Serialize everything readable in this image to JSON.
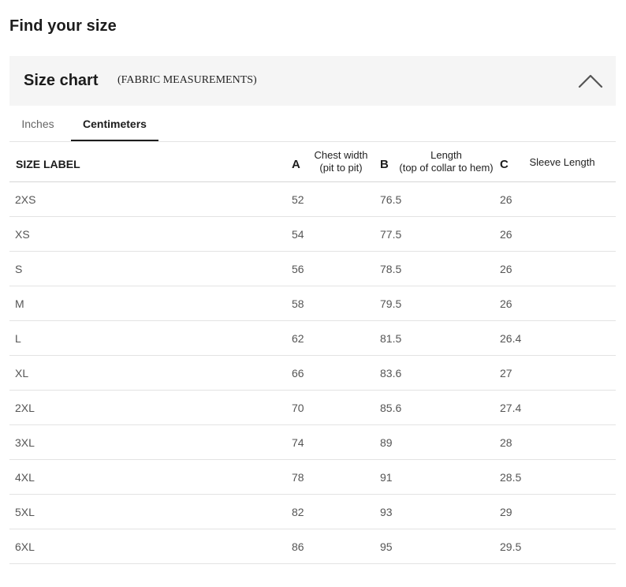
{
  "page": {
    "title": "Find your size"
  },
  "size_chart": {
    "title": "Size chart",
    "subtitle": "(FABRIC MEASUREMENTS)",
    "collapse_icon": "chevron-up-icon",
    "tabs": [
      {
        "label": "Inches",
        "active": false
      },
      {
        "label": "Centimeters",
        "active": true
      }
    ],
    "headers": {
      "size_label": "SIZE LABEL",
      "a_letter": "A",
      "a_line1": "Chest width",
      "a_line2": "(pit to pit)",
      "b_letter": "B",
      "b_line1": "Length",
      "b_line2": "(top of collar to hem)",
      "c_letter": "C",
      "c_label": "Sleeve Length"
    },
    "rows": [
      {
        "size": "2XS",
        "a": "52",
        "b": "76.5",
        "c": "26"
      },
      {
        "size": "XS",
        "a": "54",
        "b": "77.5",
        "c": "26"
      },
      {
        "size": "S",
        "a": "56",
        "b": "78.5",
        "c": "26"
      },
      {
        "size": "M",
        "a": "58",
        "b": "79.5",
        "c": "26"
      },
      {
        "size": "L",
        "a": "62",
        "b": "81.5",
        "c": "26.4"
      },
      {
        "size": "XL",
        "a": "66",
        "b": "83.6",
        "c": "27"
      },
      {
        "size": "2XL",
        "a": "70",
        "b": "85.6",
        "c": "27.4"
      },
      {
        "size": "3XL",
        "a": "74",
        "b": "89",
        "c": "28"
      },
      {
        "size": "4XL",
        "a": "78",
        "b": "91",
        "c": "28.5"
      },
      {
        "size": "5XL",
        "a": "82",
        "b": "93",
        "c": "29"
      },
      {
        "size": "6XL",
        "a": "86",
        "b": "95",
        "c": "29.5"
      }
    ]
  },
  "colors": {
    "header_bg": "#f5f5f5",
    "text_dark": "#1c1c1c",
    "text_muted": "#555555",
    "divider": "#e3e3e3"
  }
}
